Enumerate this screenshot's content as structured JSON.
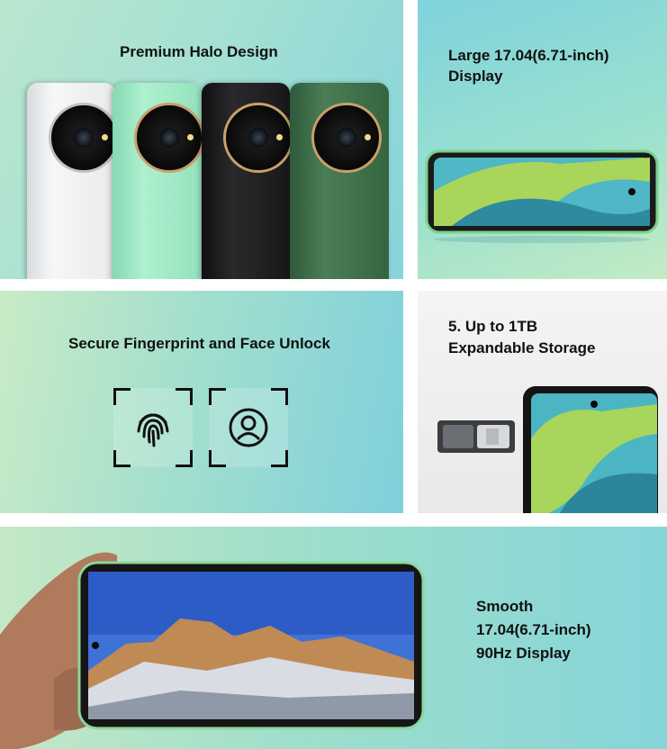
{
  "panels": {
    "design": {
      "title": "Premium Halo Design"
    },
    "display": {
      "title_line1": "Large 17.04(6.71-inch)",
      "title_line2": "Display"
    },
    "unlock": {
      "title": "Secure Fingerprint and Face Unlock"
    },
    "storage": {
      "title_line1": "5. Up to 1TB",
      "title_line2": "Expandable Storage"
    },
    "refresh": {
      "title_line1": "Smooth",
      "title_line2": "17.04(6.71-inch)",
      "title_line3": "90Hz Display"
    }
  },
  "icons": [
    "fingerprint-icon",
    "face-unlock-icon"
  ],
  "colors": {
    "phone_white": "#eef0f1",
    "phone_mint": "#9fe6c2",
    "phone_black": "#1d1d1f",
    "phone_green": "#3b6a47",
    "halo_gold": "#c9a06a"
  }
}
